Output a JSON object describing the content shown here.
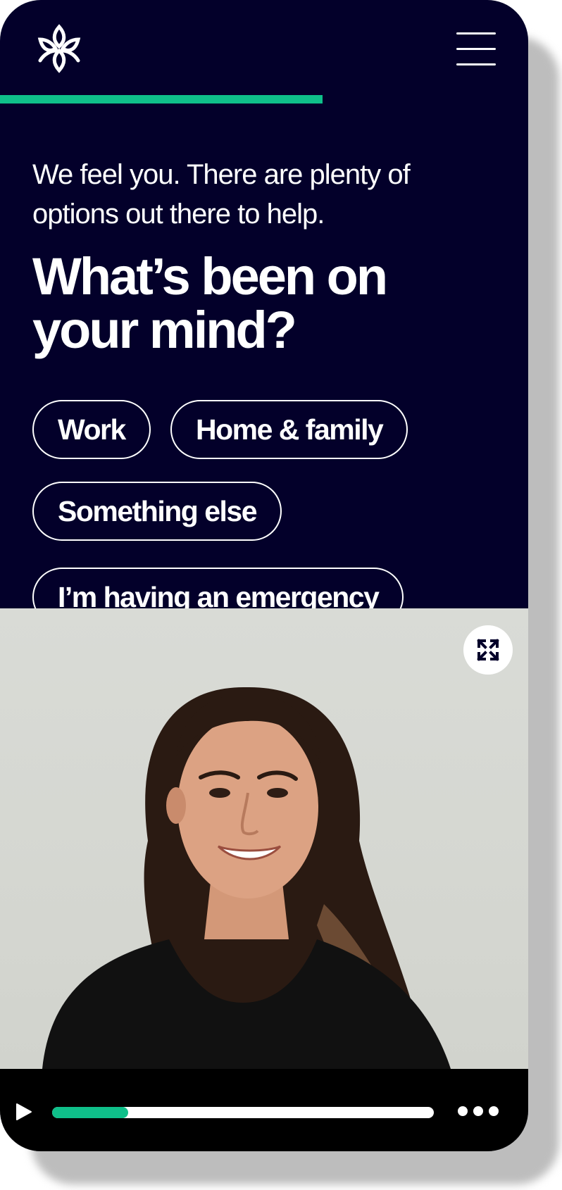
{
  "header": {
    "logo_icon": "lotus-logo-icon",
    "menu_icon": "hamburger-menu-icon",
    "progress_fraction": 0.61
  },
  "intro": "We feel you. There are plenty of options out there to help.",
  "headline_line1": "What’s been on",
  "headline_line2": "your mind?",
  "options": [
    {
      "label": "Work"
    },
    {
      "label": "Home & family"
    },
    {
      "label": "Something else"
    },
    {
      "label": "I’m having an emergency"
    }
  ],
  "video": {
    "expand_icon": "expand-icon",
    "play_icon": "play-icon",
    "more_icon": "more-dots-icon",
    "progress_fraction": 0.2
  },
  "colors": {
    "background": "#03002a",
    "accent": "#0fc08a",
    "text": "#ffffff"
  }
}
